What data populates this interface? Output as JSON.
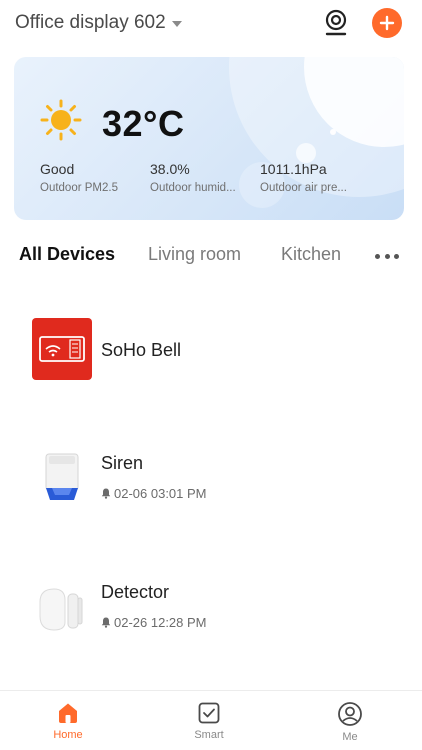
{
  "header": {
    "home_name": "Office display 602",
    "camera_icon": "camera-icon",
    "add_icon": "plus-icon",
    "accent": "#ff6a2b"
  },
  "weather": {
    "icon": "sun-icon",
    "temperature": "32°C",
    "metrics": [
      {
        "value": "Good",
        "label": "Outdoor PM2.5"
      },
      {
        "value": "38.0%",
        "label": "Outdoor humid..."
      },
      {
        "value": "1011.1hPa",
        "label": "Outdoor air pre..."
      }
    ]
  },
  "tabs": [
    {
      "label": "All Devices",
      "active": true
    },
    {
      "label": "Living room",
      "active": false
    },
    {
      "label": "Kitchen",
      "active": false
    }
  ],
  "more_icon": "more-dots-icon",
  "devices": [
    {
      "name": "SoHo Bell",
      "status": "",
      "icon": "doorbell-icon"
    },
    {
      "name": "Siren",
      "status": "02-06 03:01 PM",
      "icon": "siren-icon"
    },
    {
      "name": "Detector",
      "status": "02-26 12:28 PM",
      "icon": "detector-icon"
    }
  ],
  "bottom_nav": [
    {
      "label": "Home",
      "icon": "home-icon",
      "active": true
    },
    {
      "label": "Smart",
      "icon": "smart-icon",
      "active": false
    },
    {
      "label": "Me",
      "icon": "me-icon",
      "active": false
    }
  ]
}
